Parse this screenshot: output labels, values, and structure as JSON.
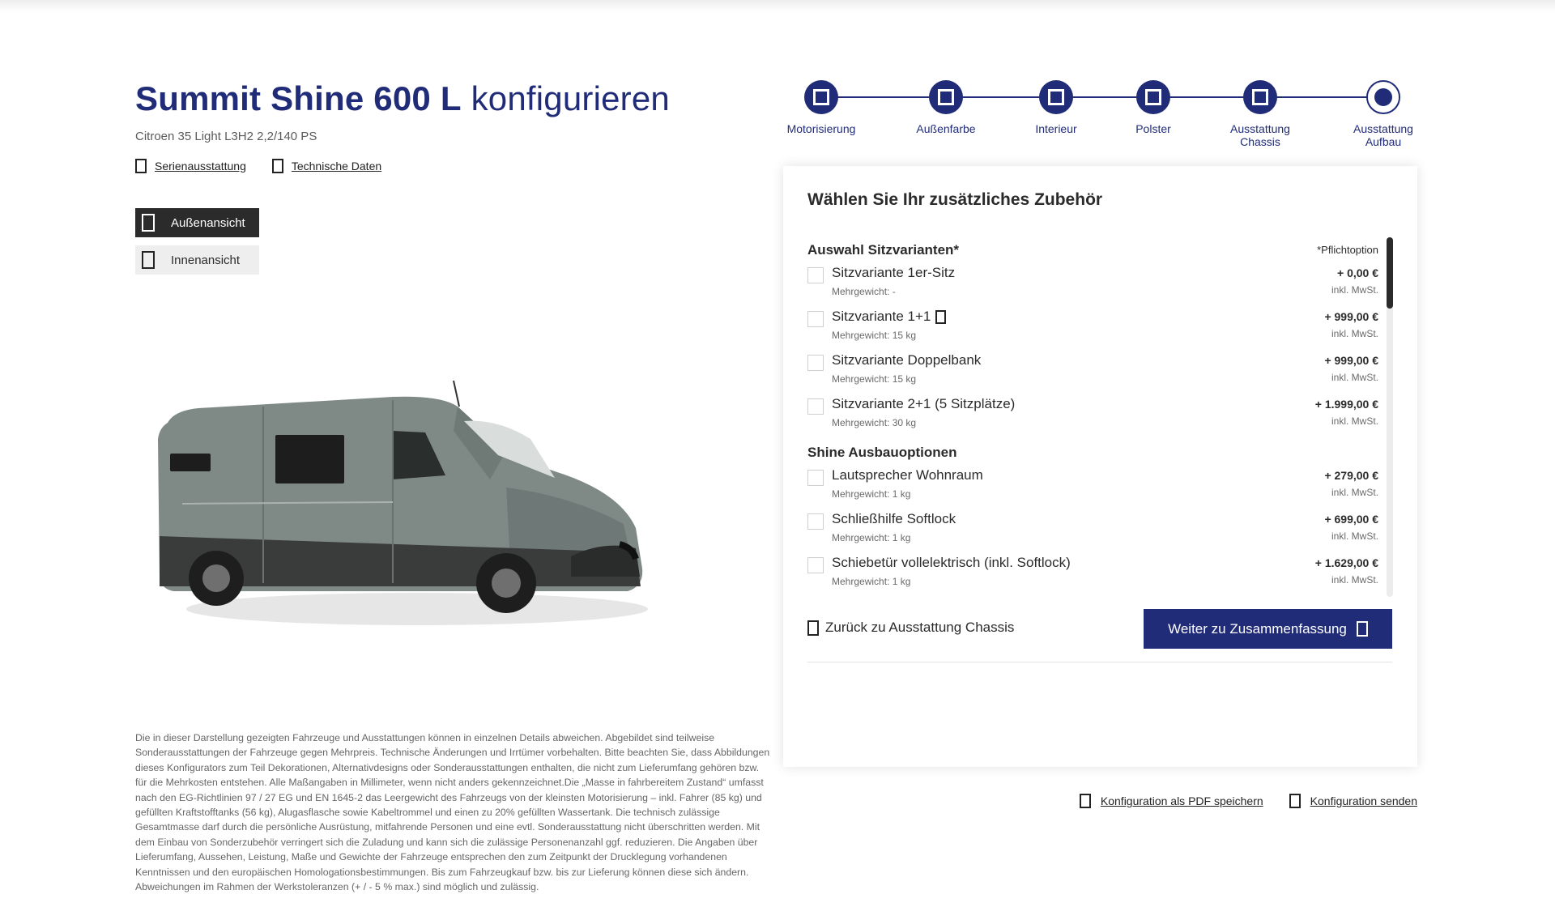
{
  "header": {
    "model": "Summit Shine 600 L",
    "verb": "konfigurieren",
    "subtitle": "Citroen 35 Light L3H2 2,2/140 PS"
  },
  "doc_links": [
    {
      "label": "Serienausstattung",
      "icon": "document-icon"
    },
    {
      "label": "Technische Daten",
      "icon": "document-icon"
    }
  ],
  "views": [
    {
      "label": "Außenansicht",
      "active": true,
      "icon": "van-exterior-icon"
    },
    {
      "label": "Innenansicht",
      "active": false,
      "icon": "van-interior-icon"
    }
  ],
  "stepper": {
    "steps": [
      {
        "label": "Motorisierung",
        "state": "done"
      },
      {
        "label": "Außenfarbe",
        "state": "done"
      },
      {
        "label": "Interieur",
        "state": "done"
      },
      {
        "label": "Polster",
        "state": "done"
      },
      {
        "label": "Ausstattung\nChassis",
        "state": "done"
      },
      {
        "label": "Ausstattung\nAufbau",
        "state": "current"
      }
    ]
  },
  "panel": {
    "title": "Wählen Sie Ihr zusätzliches Zubehör",
    "groups": [
      {
        "title": "Auswahl Sitzvarianten*",
        "note": "*Pflichtoption",
        "options": [
          {
            "name": "Sitzvariante 1er-Sitz",
            "weight": "Mehrgewicht: -",
            "price": "+ 0,00 €",
            "tax": "inkl. MwSt.",
            "info": false
          },
          {
            "name": "Sitzvariante 1+1",
            "weight": "Mehrgewicht: 15 kg",
            "price": "+ 999,00 €",
            "tax": "inkl. MwSt.",
            "info": true
          },
          {
            "name": "Sitzvariante Doppelbank",
            "weight": "Mehrgewicht: 15 kg",
            "price": "+ 999,00 €",
            "tax": "inkl. MwSt.",
            "info": false
          },
          {
            "name": "Sitzvariante 2+1 (5 Sitzplätze)",
            "weight": "Mehrgewicht: 30 kg",
            "price": "+ 1.999,00 €",
            "tax": "inkl. MwSt.",
            "info": false
          }
        ]
      },
      {
        "title": "Shine Ausbauoptionen",
        "note": "",
        "options": [
          {
            "name": "Lautsprecher Wohnraum",
            "weight": "Mehrgewicht: 1 kg",
            "price": "+ 279,00 €",
            "tax": "inkl. MwSt.",
            "info": false
          },
          {
            "name": "Schließhilfe Softlock",
            "weight": "Mehrgewicht: 1 kg",
            "price": "+ 699,00 €",
            "tax": "inkl. MwSt.",
            "info": false
          },
          {
            "name": "Schiebetür vollelektrisch (inkl. Softlock)",
            "weight": "Mehrgewicht: 1 kg",
            "price": "+ 1.629,00 €",
            "tax": "inkl. MwSt.",
            "info": false
          }
        ]
      }
    ],
    "back_label": "Zurück zu Ausstattung Chassis",
    "next_label": "Weiter zu Zusammenfassung"
  },
  "save_links": [
    {
      "label": "Konfiguration als PDF speichern",
      "icon": "pdf-icon"
    },
    {
      "label": "Konfiguration senden",
      "icon": "send-icon"
    }
  ],
  "disclaimer": "Die in dieser Darstellung gezeigten Fahrzeuge und Ausstattungen können in einzelnen Details abweichen. Abgebildet sind teilweise Sonderausstattungen der Fahrzeuge gegen Mehrpreis. Technische Änderungen und Irrtümer vorbehalten. Bitte beachten Sie, dass Abbildungen dieses Konfigurators zum Teil Dekorationen, Alternativdesigns oder Sonderausstattungen enthalten, die nicht zum Lieferumfang gehören bzw. für die Mehrkosten entstehen. Alle Maßangaben in Millimeter, wenn nicht anders gekennzeichnet.Die „Masse in fahrbereitem Zustand“ umfasst nach den EG-Richtlinien 97 / 27 EG und EN 1645-2 das Leergewicht des Fahrzeugs von der kleinsten Motorisierung – inkl. Fahrer (85 kg) und gefüllten Kraftstofftanks (56 kg), Alugasflasche sowie Kabeltrommel und einen zu 20% gefüllten Wassertank. Die technisch zulässige Gesamtmasse darf durch die persönliche Ausrüstung, mitfahrende Personen und eine evtl. Sonderausstattung nicht überschritten werden. Mit dem Einbau von Sonderzubehör verringert sich die Zuladung und kann sich die zulässige Personenanzahl ggf. reduzieren. Die Angaben über Lieferumfang, Aussehen, Leistung, Maße und Gewichte der Fahrzeuge entsprechen den zum Zeitpunkt der Drucklegung vorhandenen Kenntnissen und den europäischen Homologationsbestimmungen. Bis zum Fahrzeugkauf bzw. bis zur Lieferung können diese sich ändern. Abweichungen im Rahmen der Werkstoleranzen (+ / - 5 % max.) sind möglich und zulässig.",
  "colors": {
    "brand": "#212c78",
    "text": "#2b2b2b",
    "active_view_bg": "#2b2b2b",
    "inactive_view_bg": "#eeeeee",
    "van_body": "#7f8a87"
  }
}
